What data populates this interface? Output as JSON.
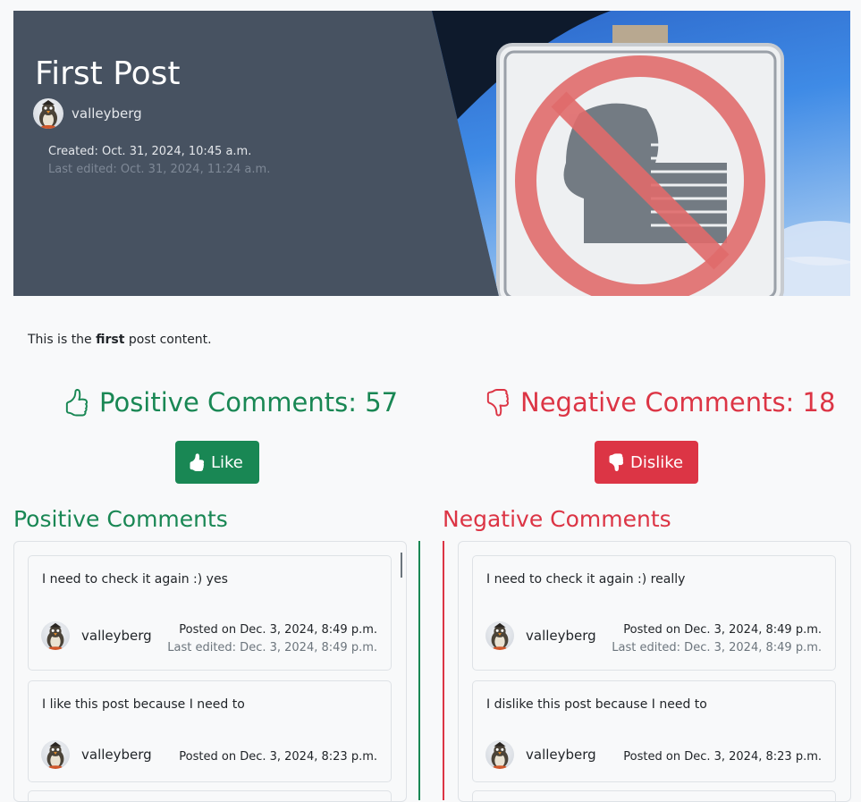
{
  "post": {
    "title": "First Post",
    "author": "valleyberg",
    "created": "Created: Oct. 31, 2024, 10:45 a.m.",
    "last_edited": "Last edited: Oct. 31, 2024, 11:24 a.m.",
    "content_before": "This is the ",
    "content_bold": "first",
    "content_after": " post content."
  },
  "reactions": {
    "positive_label": "Positive Comments: 57",
    "negative_label": "Negative Comments: 18",
    "like_label": "Like",
    "dislike_label": "Dislike"
  },
  "colors": {
    "positive": "#198754",
    "negative": "#dc3545",
    "hero_bg": "#475261"
  },
  "positive_comments": {
    "heading": "Positive Comments",
    "items": [
      {
        "text": "I need to check it again :) yes",
        "author": "valleyberg",
        "posted": "Posted on Dec. 3, 2024, 8:49 p.m.",
        "edited": "Last edited: Dec. 3, 2024, 8:49 p.m."
      },
      {
        "text": "I like this post because I need to",
        "author": "valleyberg",
        "posted": "Posted on Dec. 3, 2024, 8:23 p.m."
      }
    ]
  },
  "negative_comments": {
    "heading": "Negative Comments",
    "items": [
      {
        "text": "I need to check it again :) really",
        "author": "valleyberg",
        "posted": "Posted on Dec. 3, 2024, 8:49 p.m.",
        "edited": "Last edited: Dec. 3, 2024, 8:49 p.m."
      },
      {
        "text": "I dislike this post because I need to",
        "author": "valleyberg",
        "posted": "Posted on Dec. 3, 2024, 8:23 p.m."
      }
    ]
  },
  "icons": {
    "positive_header": "thumbs-up-outline-icon",
    "negative_header": "thumbs-down-outline-icon",
    "like_button": "thumbs-up-solid-icon",
    "dislike_button": "thumbs-down-solid-icon"
  }
}
